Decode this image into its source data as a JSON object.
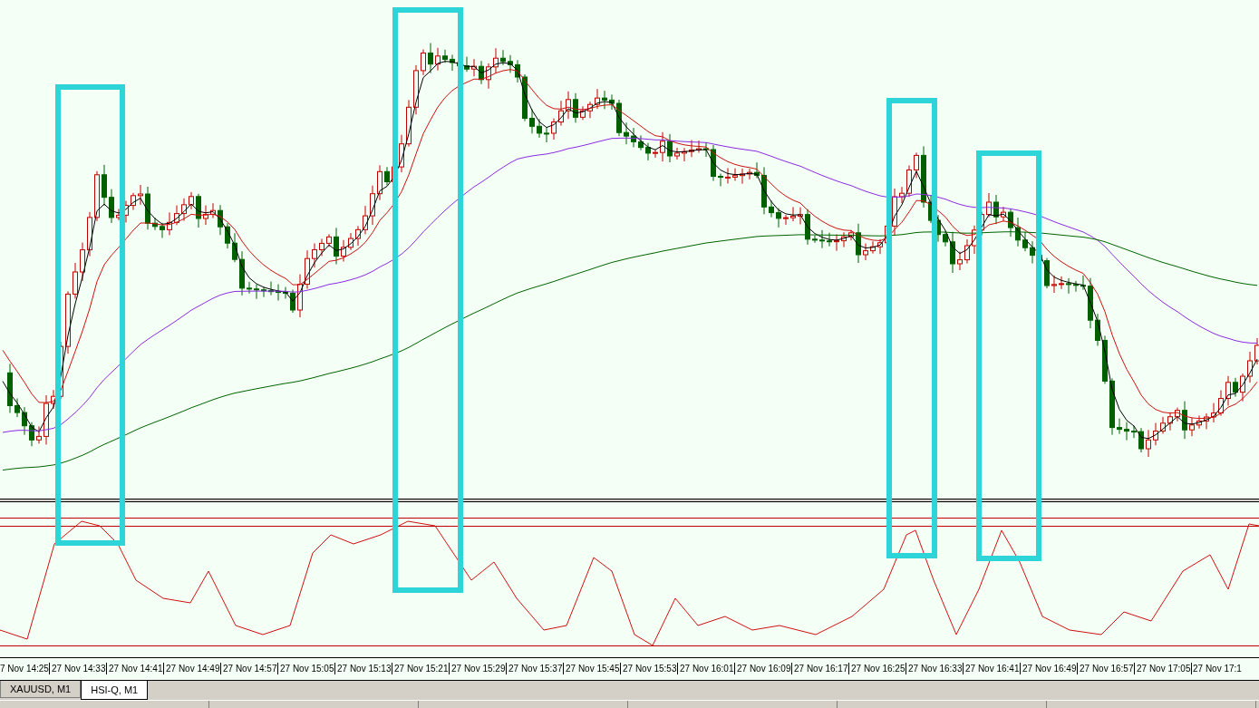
{
  "chart": {
    "time_labels": [
      "7 Nov 14:25",
      "27 Nov 14:33",
      "27 Nov 14:41",
      "27 Nov 14:49",
      "27 Nov 14:57",
      "27 Nov 15:05",
      "27 Nov 15:13",
      "27 Nov 15:21",
      "27 Nov 15:29",
      "27 Nov 15:37",
      "27 Nov 15:45",
      "27 Nov 15:53",
      "27 Nov 16:01",
      "27 Nov 16:09",
      "27 Nov 16:17",
      "27 Nov 16:25",
      "27 Nov 16:33",
      "27 Nov 16:41",
      "27 Nov 16:49",
      "27 Nov 16:57",
      "27 Nov 17:05",
      "27 Nov 17:1"
    ]
  },
  "tabs": [
    {
      "label": "XAUUSD, M1",
      "selected": false
    },
    {
      "label": "HSI-Q, M1",
      "selected": true
    }
  ]
}
